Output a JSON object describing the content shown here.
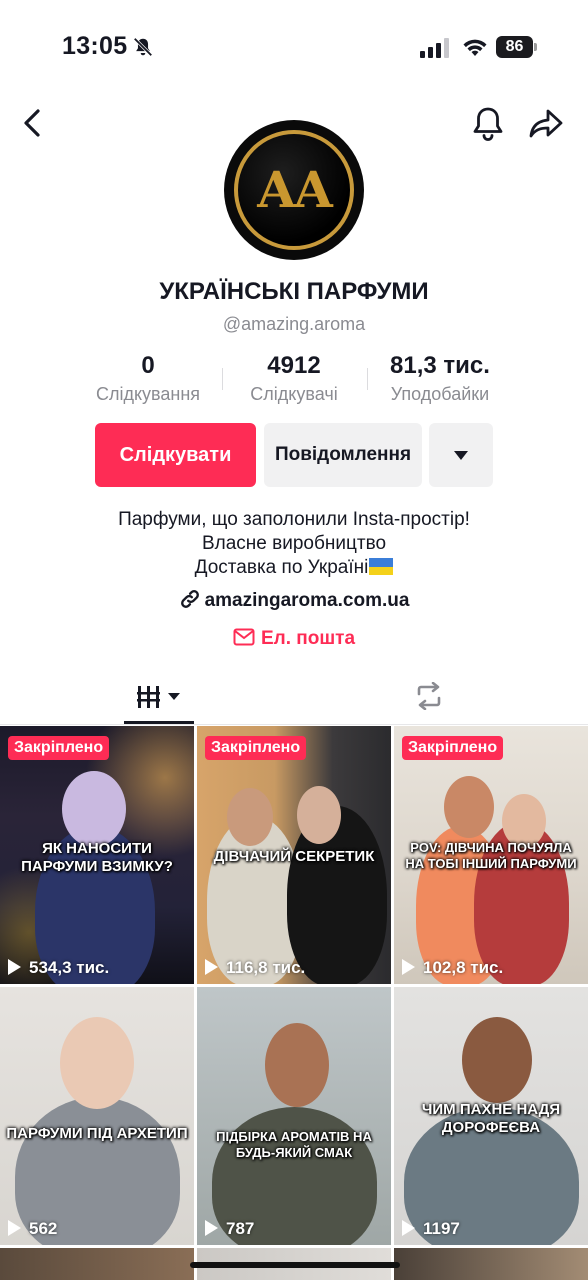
{
  "status_bar": {
    "time": "13:05",
    "battery": "86",
    "icons": [
      "bell-off-icon",
      "signal-icon",
      "wifi-icon",
      "battery-icon"
    ]
  },
  "nav": {
    "icons": [
      "chevron-left-icon",
      "bell-icon",
      "share-icon"
    ]
  },
  "profile": {
    "avatar_text": "AA",
    "name": "УКРАЇНСЬКІ ПАРФУМИ",
    "handle": "@amazing.aroma",
    "stats": [
      {
        "value": "0",
        "label": "Слідкування"
      },
      {
        "value": "4912",
        "label": "Слідкувачі"
      },
      {
        "value": "81,3 тис.",
        "label": "Уподобайки"
      }
    ],
    "buttons": {
      "follow": "Слідкувати",
      "message": "Повідомлення"
    },
    "bio": [
      "Парфуми, що заполонили Insta-простір!",
      "Власне виробництво",
      "Доставка по Україні"
    ],
    "link": "amazingaroma.com.ua",
    "email": "Ел. пошта"
  },
  "tabs": [
    "videos-grid-icon",
    "repost-icon"
  ],
  "videos": [
    {
      "pinned": "Закріплено",
      "caption": "ЯК НАНОСИТИ ПАРФУМИ ВЗИМКУ?",
      "views": "534,3 тис."
    },
    {
      "pinned": "Закріплено",
      "caption": "ДІВЧАЧИЙ СЕКРЕТИК",
      "views": "116,8 тис."
    },
    {
      "pinned": "Закріплено",
      "caption": "POV: ДІВЧИНА ПОЧУЯЛА НА ТОБІ ІНШИЙ ПАРФУМИ",
      "views": "102,8 тис."
    },
    {
      "pinned": "",
      "caption": "ПАРФУМИ ПІД АРХЕТИП",
      "views": "562"
    },
    {
      "pinned": "",
      "caption": "ПІДБІРКА АРОМАТІВ НА БУДЬ-ЯКИЙ СМАК",
      "views": "787"
    },
    {
      "pinned": "",
      "caption": "ЧИМ ПАХНЕ НАДЯ ДОРОФЕЄВА",
      "views": "1197"
    }
  ],
  "colors": {
    "accent": "#fe2c55",
    "secondary_button": "#f1f1f2",
    "muted_text": "#8a8b91",
    "avatar_gold": "#c9972f"
  }
}
